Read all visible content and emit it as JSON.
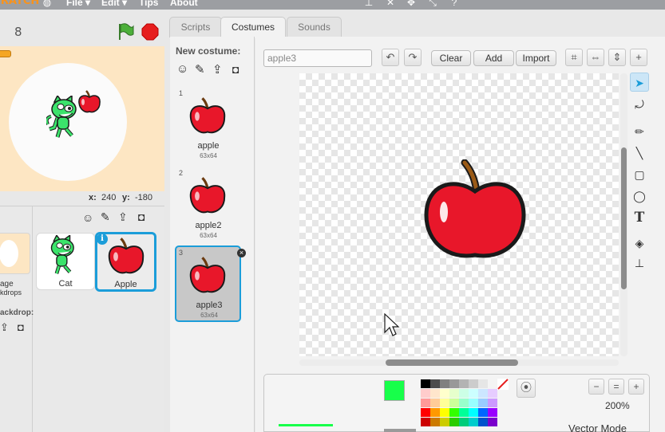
{
  "menubar": {
    "logo": "SCRATCH",
    "menu_file": "File ▾",
    "menu_edit": "Edit ▾",
    "menu_tips": "Tips",
    "menu_about": "About"
  },
  "stage": {
    "version": "8",
    "x_label": "x:",
    "x_value": "240",
    "y_label": "y:",
    "y_value": "-180"
  },
  "sprite_panel": {
    "stage_label_line1": "age",
    "stage_label_line2": "kdrops",
    "new_backdrop_label": "ackdrop:",
    "sprites": [
      {
        "name": "Cat"
      },
      {
        "name": "Apple"
      }
    ]
  },
  "tabs": [
    {
      "label": "Scripts"
    },
    {
      "label": "Costumes"
    },
    {
      "label": "Sounds"
    }
  ],
  "costumes": {
    "new_costume_label": "New costume:",
    "items": [
      {
        "number": "1",
        "name": "apple",
        "size": "63x64"
      },
      {
        "number": "2",
        "name": "apple2",
        "size": "63x64"
      },
      {
        "number": "3",
        "name": "apple3",
        "size": "63x64"
      }
    ]
  },
  "editor": {
    "costume_name_value": "apple3",
    "clear_label": "Clear",
    "add_label": "Add",
    "import_label": "Import",
    "zoom_level": "200%",
    "mode_label": "Vector Mode"
  },
  "colors": {
    "accent": "#1b9dd9",
    "stage_bg": "#fde6c3",
    "primary_color": "#17ff4a",
    "apple_red": "#e8172a"
  },
  "palette": [
    "#000000",
    "#4d4d4d",
    "#808080",
    "#999999",
    "#b3b3b3",
    "#cccccc",
    "#e6e6e6",
    "#ffffff",
    "#ffcccc",
    "#ffe6cc",
    "#ffffcc",
    "#e6ffcc",
    "#ccffe6",
    "#ccffff",
    "#cce6ff",
    "#e6ccff",
    "#ff9999",
    "#ffcc99",
    "#ffff99",
    "#ccff99",
    "#99ffcc",
    "#99ffff",
    "#99ccff",
    "#cc99ff",
    "#ff0000",
    "#ff9900",
    "#ffff00",
    "#33ff00",
    "#00ff99",
    "#00ffff",
    "#0066ff",
    "#9900ff",
    "#cc0000",
    "#cc7a00",
    "#cccc00",
    "#29cc00",
    "#00cc7a",
    "#00cccc",
    "#0052cc",
    "#7a00cc"
  ]
}
